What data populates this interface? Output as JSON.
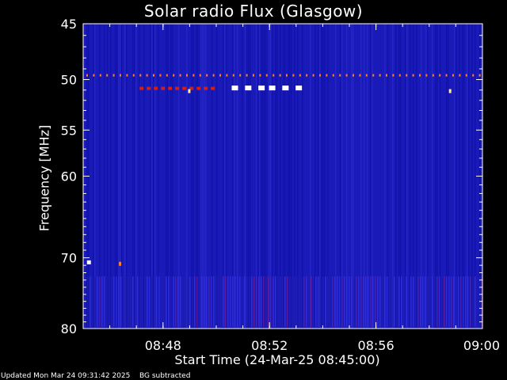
{
  "page": {
    "footer_updated": "Updated Mon Mar 24 09:31:42 2025",
    "footer_bg": "BG subtracted"
  },
  "colors": {
    "background": "#000000",
    "plot_base": "#1a1ab8",
    "axis": "#ffffff",
    "burst_red": "#cc2020",
    "burst_orange": "#ff8020",
    "burst_white": "#ffffff",
    "burst_yellow": "#ffee80"
  },
  "chart_data": {
    "type": "heatmap",
    "title": "Solar radio Flux (Glasgow)",
    "xlabel": "Start Time (24-Mar-25 08:45:00)",
    "ylabel": "Frequency [MHz]",
    "xlim": [
      "08:45",
      "09:00"
    ],
    "ylim": [
      45,
      80
    ],
    "y_scale": "log",
    "x_ticks": [
      "08:48",
      "08:52",
      "08:56",
      "09:00"
    ],
    "y_ticks": [
      45,
      50,
      55,
      60,
      70,
      80
    ],
    "grid": false,
    "features": [
      {
        "kind": "dotted_band",
        "freq_mhz": 49.6,
        "from": "08:45",
        "to": "09:00",
        "color": "orange"
      },
      {
        "kind": "dotted_band",
        "freq_mhz": 50.8,
        "from": "08:47",
        "to": "08:50",
        "color": "red"
      },
      {
        "kind": "white_blocks",
        "freq_mhz": 50.8,
        "times": [
          "08:50.7",
          "08:51.2",
          "08:51.7",
          "08:52.1",
          "08:52.6",
          "08:53.1"
        ]
      },
      {
        "kind": "spot",
        "freq_mhz": 51.1,
        "time": "08:49.0",
        "color": "yellow"
      },
      {
        "kind": "spot",
        "freq_mhz": 51.1,
        "time": "08:58.8",
        "color": "yellow"
      },
      {
        "kind": "spot",
        "freq_mhz": 70.6,
        "time": "08:45.2",
        "color": "white"
      },
      {
        "kind": "spot",
        "freq_mhz": 70.8,
        "time": "08:46.4",
        "color": "orange"
      },
      {
        "kind": "stripe_region",
        "freq_from_mhz": 72.5,
        "freq_to_mhz": 78,
        "from": "08:45",
        "to": "09:00"
      }
    ]
  }
}
